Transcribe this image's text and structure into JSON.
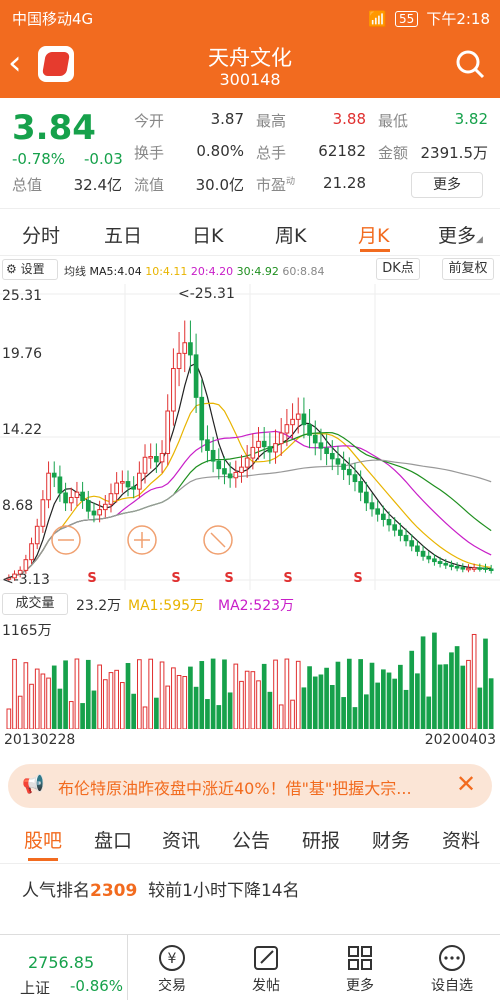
{
  "status": {
    "carrier": "中国移动4G",
    "battery": "55",
    "time": "下午2:18"
  },
  "header": {
    "name": "天舟文化",
    "code": "300148"
  },
  "quote": {
    "price": "3.84",
    "pct": "-0.78%",
    "chg": "-0.03",
    "cap_label": "总值",
    "cap": "32.4亿",
    "float_label": "流值",
    "float": "30.0亿",
    "open_label": "今开",
    "open": "3.87",
    "high_label": "最高",
    "high": "3.88",
    "low_label": "最低",
    "low": "3.82",
    "turn_label": "换手",
    "turn": "0.80%",
    "hands_label": "总手",
    "hands": "62182",
    "amount_label": "金额",
    "amount": "2391.5万",
    "pe_label": "市盈",
    "pe_sup": "动",
    "pe": "21.28",
    "more": "更多"
  },
  "tabs": [
    {
      "label": "分时"
    },
    {
      "label": "五日"
    },
    {
      "label": "日K"
    },
    {
      "label": "周K"
    },
    {
      "label": "月K"
    },
    {
      "label": "更多"
    }
  ],
  "ma_bar": {
    "settings": "设置",
    "ma_title": "均线",
    "ma5": "MA5:4.04",
    "ma10": "10:4.11",
    "ma20": "20:4.20",
    "ma30": "30:4.92",
    "ma60": "60:8.84",
    "dk": "DK点",
    "fq": "前复权"
  },
  "chart_data": {
    "type": "candlestick",
    "y_ticks": [
      "25.31",
      "19.76",
      "14.22",
      "8.68"
    ],
    "max_label": "<-25.31",
    "min_label": "<-3.13",
    "ylim": [
      3.13,
      25.31
    ],
    "sell_marks": [
      "S",
      "S",
      "S",
      "S",
      "S"
    ],
    "volume": {
      "label": "成交量",
      "value": "23.2万",
      "ma1": "MA1:595万",
      "ma2": "MA2:523万",
      "top_tick": "1165万"
    },
    "x_start": "20130228",
    "x_end": "20200403",
    "colors": {
      "up": "#e03030",
      "down": "#16a14b",
      "ma5": "#222222",
      "ma10": "#e8b400",
      "ma20": "#c81ec8",
      "ma30": "#1f8f1f",
      "ma60": "#999999"
    }
  },
  "news": {
    "text": "布伦特原油昨夜盘中涨近40%！借\"基\"把握大宗..."
  },
  "bottom_tabs": [
    {
      "label": "股吧"
    },
    {
      "label": "盘口"
    },
    {
      "label": "资讯"
    },
    {
      "label": "公告"
    },
    {
      "label": "研报"
    },
    {
      "label": "财务"
    },
    {
      "label": "资料"
    }
  ],
  "rank": {
    "prefix": "人气排名",
    "num": "2309",
    "suffix": "较前1小时下降14名"
  },
  "footer": {
    "index": "2756.85",
    "index_name": "上证",
    "index_pct": "-0.86%",
    "trade": "交易",
    "post": "发帖",
    "more": "更多",
    "fav": "设自选"
  }
}
